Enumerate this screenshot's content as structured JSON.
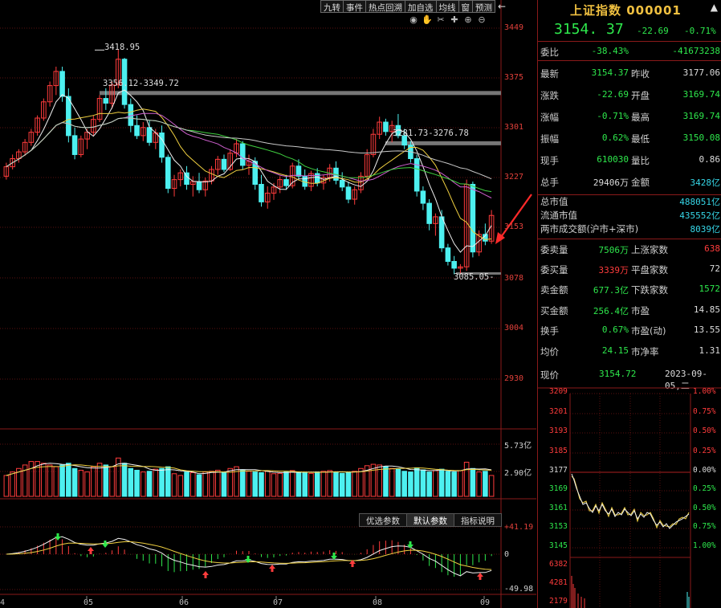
{
  "toolbar": {
    "buttons": [
      "九转",
      "事件",
      "热点回溯",
      "加自选",
      "均线",
      "窗",
      "预测"
    ],
    "back_icon": "back-arrow-icon"
  },
  "tools": [
    "eye-icon",
    "hand-icon",
    "scissor-icon",
    "cross-icon",
    "zoom-in-icon",
    "zoom-out-icon"
  ],
  "chart_data": {
    "type": "candlestick",
    "price_axis": [
      "3449",
      "3375",
      "3301",
      "3227",
      "3153",
      "3078",
      "3004",
      "2930"
    ],
    "ylim": [
      2930,
      3449
    ],
    "volume_axis": [
      "5.73亿",
      "2.90亿"
    ],
    "macd_axis": [
      "+41.19",
      "0",
      "-49.98"
    ],
    "month_labels": [
      "4",
      "05",
      "06",
      "07",
      "08",
      "09"
    ],
    "annotations": {
      "high_label": "3418.95",
      "gap1": "3356.12-3349.72",
      "gap2": "3281.73-3276.78",
      "low_label": "3085.05"
    },
    "candles": [
      [
        3230,
        3250,
        3225,
        3244
      ],
      [
        3244,
        3262,
        3240,
        3256
      ],
      [
        3256,
        3270,
        3250,
        3266
      ],
      [
        3266,
        3285,
        3260,
        3280
      ],
      [
        3280,
        3300,
        3275,
        3295
      ],
      [
        3295,
        3320,
        3290,
        3316
      ],
      [
        3316,
        3345,
        3312,
        3340
      ],
      [
        3340,
        3370,
        3333,
        3364
      ],
      [
        3364,
        3392,
        3350,
        3385
      ],
      [
        3385,
        3392,
        3340,
        3348
      ],
      [
        3348,
        3360,
        3280,
        3290
      ],
      [
        3290,
        3302,
        3255,
        3262
      ],
      [
        3262,
        3290,
        3258,
        3285
      ],
      [
        3285,
        3300,
        3270,
        3295
      ],
      [
        3295,
        3320,
        3290,
        3314
      ],
      [
        3314,
        3350,
        3310,
        3345
      ],
      [
        3345,
        3360,
        3328,
        3338
      ],
      [
        3338,
        3370,
        3330,
        3365
      ],
      [
        3365,
        3418,
        3360,
        3403
      ],
      [
        3403,
        3405,
        3330,
        3336
      ],
      [
        3336,
        3345,
        3295,
        3305
      ],
      [
        3305,
        3320,
        3285,
        3290
      ],
      [
        3290,
        3310,
        3282,
        3302
      ],
      [
        3302,
        3312,
        3275,
        3280
      ],
      [
        3280,
        3300,
        3270,
        3294
      ],
      [
        3294,
        3305,
        3250,
        3258
      ],
      [
        3258,
        3262,
        3205,
        3212
      ],
      [
        3212,
        3232,
        3200,
        3225
      ],
      [
        3225,
        3240,
        3215,
        3235
      ],
      [
        3235,
        3245,
        3210,
        3218
      ],
      [
        3218,
        3230,
        3200,
        3222
      ],
      [
        3222,
        3235,
        3205,
        3210
      ],
      [
        3210,
        3228,
        3200,
        3223
      ],
      [
        3223,
        3245,
        3218,
        3240
      ],
      [
        3240,
        3260,
        3232,
        3255
      ],
      [
        3255,
        3262,
        3236,
        3240
      ],
      [
        3240,
        3270,
        3238,
        3264
      ],
      [
        3264,
        3285,
        3258,
        3278
      ],
      [
        3278,
        3282,
        3240,
        3246
      ],
      [
        3246,
        3262,
        3232,
        3252
      ],
      [
        3252,
        3258,
        3210,
        3218
      ],
      [
        3218,
        3232,
        3185,
        3192
      ],
      [
        3192,
        3215,
        3182,
        3205
      ],
      [
        3205,
        3220,
        3195,
        3214
      ],
      [
        3214,
        3230,
        3205,
        3225
      ],
      [
        3225,
        3232,
        3210,
        3216
      ],
      [
        3216,
        3250,
        3212,
        3245
      ],
      [
        3245,
        3255,
        3225,
        3230
      ],
      [
        3230,
        3240,
        3210,
        3215
      ],
      [
        3215,
        3238,
        3208,
        3234
      ],
      [
        3234,
        3242,
        3215,
        3220
      ],
      [
        3220,
        3232,
        3210,
        3228
      ],
      [
        3228,
        3248,
        3222,
        3242
      ],
      [
        3242,
        3252,
        3218,
        3224
      ],
      [
        3224,
        3236,
        3208,
        3214
      ],
      [
        3214,
        3222,
        3190,
        3196
      ],
      [
        3196,
        3215,
        3188,
        3210
      ],
      [
        3210,
        3236,
        3205,
        3230
      ],
      [
        3230,
        3270,
        3225,
        3262
      ],
      [
        3262,
        3300,
        3258,
        3292
      ],
      [
        3292,
        3318,
        3285,
        3310
      ],
      [
        3310,
        3315,
        3290,
        3296
      ],
      [
        3296,
        3312,
        3280,
        3305
      ],
      [
        3305,
        3322,
        3286,
        3290
      ],
      [
        3290,
        3300,
        3270,
        3276
      ],
      [
        3276,
        3282,
        3250,
        3256
      ],
      [
        3256,
        3262,
        3200,
        3208
      ],
      [
        3208,
        3215,
        3180,
        3190
      ],
      [
        3190,
        3196,
        3150,
        3160
      ],
      [
        3160,
        3175,
        3142,
        3170
      ],
      [
        3170,
        3180,
        3118,
        3124
      ],
      [
        3124,
        3130,
        3098,
        3104
      ],
      [
        3104,
        3112,
        3085,
        3094
      ],
      [
        3094,
        3100,
        3085,
        3096
      ],
      [
        3096,
        3225,
        3090,
        3218
      ],
      [
        3218,
        3222,
        3110,
        3118
      ],
      [
        3118,
        3150,
        3112,
        3144
      ],
      [
        3144,
        3160,
        3128,
        3134
      ],
      [
        3134,
        3180,
        3130,
        3172
      ]
    ],
    "volumes": [
      0.6,
      0.7,
      0.8,
      0.9,
      1.0,
      1.0,
      0.95,
      0.9,
      0.85,
      0.9,
      0.95,
      0.8,
      0.75,
      0.7,
      0.85,
      0.95,
      0.9,
      0.85,
      1.1,
      0.95,
      0.8,
      0.75,
      0.7,
      0.72,
      0.78,
      0.8,
      0.85,
      0.65,
      0.6,
      0.7,
      0.68,
      0.62,
      0.7,
      0.72,
      0.75,
      0.7,
      0.8,
      0.85,
      0.75,
      0.72,
      0.7,
      0.68,
      0.72,
      0.65,
      0.66,
      0.7,
      0.74,
      0.7,
      0.68,
      0.66,
      0.7,
      0.72,
      0.74,
      0.7,
      0.66,
      0.68,
      0.72,
      0.8,
      0.88,
      0.92,
      0.9,
      0.85,
      0.8,
      0.78,
      0.72,
      0.7,
      0.82,
      0.76,
      0.7,
      0.74,
      0.78,
      0.72,
      0.7,
      0.74,
      0.98,
      0.8,
      0.7,
      0.72,
      0.6
    ]
  },
  "price_notes": {
    "high": "3418.95",
    "gap1": "3356.12-3349.72",
    "gap2": "3281.73-3276.78",
    "low": "3085.05-"
  },
  "param_tabs": [
    "优选参数",
    "默认参数",
    "指标说明"
  ],
  "quote": {
    "title": "上证指数 000001",
    "price": "3154. 37",
    "change": "-22.69",
    "pct": "-0.71%"
  },
  "stats": [
    {
      "l": "委比",
      "v": "-38.43%",
      "vc": "green",
      "l2": "",
      "v2": "-41673238",
      "v2c": "green"
    },
    {
      "l": "最新",
      "v": "3154.37",
      "vc": "green",
      "l2": "昨收",
      "v2": "3177.06",
      "v2c": "white"
    },
    {
      "l": "涨跌",
      "v": "-22.69",
      "vc": "green",
      "l2": "开盘",
      "v2": "3169.74",
      "v2c": "green"
    },
    {
      "l": "涨幅",
      "v": "-0.71%",
      "vc": "green",
      "l2": "最高",
      "v2": "3169.74",
      "v2c": "green"
    },
    {
      "l": "振幅",
      "v": "0.62%",
      "vc": "green",
      "l2": "最低",
      "v2": "3150.08",
      "v2c": "green"
    },
    {
      "l": "现手",
      "v": "610030",
      "vc": "green",
      "l2": "量比",
      "v2": "0.86",
      "v2c": "white"
    },
    {
      "l": "总手",
      "v": "29406万",
      "vc": "white",
      "l2": "金额",
      "v2": "3428亿",
      "v2c": "cyan"
    },
    {
      "l": "总市值",
      "v": "",
      "vc": "white",
      "l2": "",
      "v2": "488051亿",
      "v2c": "cyan"
    },
    {
      "l": "流通市值",
      "v": "",
      "vc": "white",
      "l2": "",
      "v2": "435552亿",
      "v2c": "cyan"
    },
    {
      "l": "两市成交额(沪市+深市)",
      "v": "",
      "vc": "white",
      "l2": "",
      "v2": "8039亿",
      "v2c": "cyan"
    },
    {
      "l": "委卖量",
      "v": "7506万",
      "vc": "green",
      "l2": "上涨家数",
      "v2": "638",
      "v2c": "red"
    },
    {
      "l": "委买量",
      "v": "3339万",
      "vc": "red",
      "l2": "平盘家数",
      "v2": "72",
      "v2c": "white"
    },
    {
      "l": "卖金额",
      "v": "677.3亿",
      "vc": "green",
      "l2": "下跌家数",
      "v2": "1572",
      "v2c": "green"
    },
    {
      "l": "买金额",
      "v": "256.4亿",
      "vc": "green",
      "l2": "市盈",
      "v2": "14.85",
      "v2c": "white"
    },
    {
      "l": "换手",
      "v": "0.67%",
      "vc": "green",
      "l2": "市盈(动)",
      "v2": "13.55",
      "v2c": "white"
    },
    {
      "l": "均价",
      "v": "24.15",
      "vc": "green",
      "l2": "市净率",
      "v2": "1.31",
      "v2c": "white"
    }
  ],
  "current": {
    "label": "现价",
    "value": "3154.72",
    "date": "2023-09-05,二"
  },
  "mini": {
    "left": [
      "3209",
      "3201",
      "3193",
      "3185",
      "3177",
      "3169",
      "3161",
      "3153",
      "3145",
      "6382",
      "4281",
      "2179"
    ],
    "right": [
      "1.00%",
      "0.75%",
      "0.50%",
      "0.25%",
      "0.00%",
      "0.25%",
      "0.50%",
      "0.75%",
      "1.00%"
    ]
  }
}
